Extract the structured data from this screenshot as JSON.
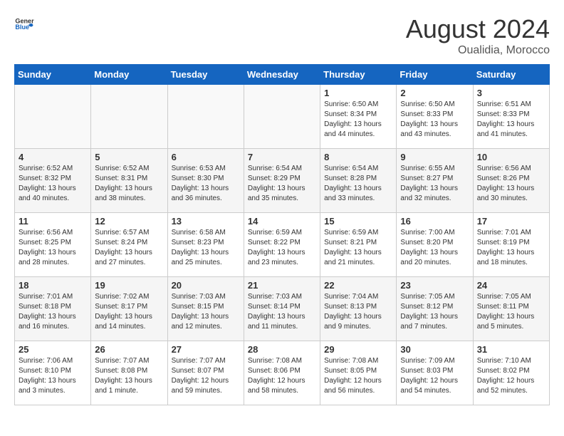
{
  "header": {
    "logo_general": "General",
    "logo_blue": "Blue",
    "month_year": "August 2024",
    "location": "Oualidia, Morocco"
  },
  "days_header": [
    "Sunday",
    "Monday",
    "Tuesday",
    "Wednesday",
    "Thursday",
    "Friday",
    "Saturday"
  ],
  "weeks": [
    [
      {
        "day": "",
        "empty": true
      },
      {
        "day": "",
        "empty": true
      },
      {
        "day": "",
        "empty": true
      },
      {
        "day": "",
        "empty": true
      },
      {
        "day": "1",
        "sunrise": "6:50 AM",
        "sunset": "8:34 PM",
        "daylight": "13 hours and 44 minutes."
      },
      {
        "day": "2",
        "sunrise": "6:50 AM",
        "sunset": "8:33 PM",
        "daylight": "13 hours and 43 minutes."
      },
      {
        "day": "3",
        "sunrise": "6:51 AM",
        "sunset": "8:33 PM",
        "daylight": "13 hours and 41 minutes."
      }
    ],
    [
      {
        "day": "4",
        "sunrise": "6:52 AM",
        "sunset": "8:32 PM",
        "daylight": "13 hours and 40 minutes."
      },
      {
        "day": "5",
        "sunrise": "6:52 AM",
        "sunset": "8:31 PM",
        "daylight": "13 hours and 38 minutes."
      },
      {
        "day": "6",
        "sunrise": "6:53 AM",
        "sunset": "8:30 PM",
        "daylight": "13 hours and 36 minutes."
      },
      {
        "day": "7",
        "sunrise": "6:54 AM",
        "sunset": "8:29 PM",
        "daylight": "13 hours and 35 minutes."
      },
      {
        "day": "8",
        "sunrise": "6:54 AM",
        "sunset": "8:28 PM",
        "daylight": "13 hours and 33 minutes."
      },
      {
        "day": "9",
        "sunrise": "6:55 AM",
        "sunset": "8:27 PM",
        "daylight": "13 hours and 32 minutes."
      },
      {
        "day": "10",
        "sunrise": "6:56 AM",
        "sunset": "8:26 PM",
        "daylight": "13 hours and 30 minutes."
      }
    ],
    [
      {
        "day": "11",
        "sunrise": "6:56 AM",
        "sunset": "8:25 PM",
        "daylight": "13 hours and 28 minutes."
      },
      {
        "day": "12",
        "sunrise": "6:57 AM",
        "sunset": "8:24 PM",
        "daylight": "13 hours and 27 minutes."
      },
      {
        "day": "13",
        "sunrise": "6:58 AM",
        "sunset": "8:23 PM",
        "daylight": "13 hours and 25 minutes."
      },
      {
        "day": "14",
        "sunrise": "6:59 AM",
        "sunset": "8:22 PM",
        "daylight": "13 hours and 23 minutes."
      },
      {
        "day": "15",
        "sunrise": "6:59 AM",
        "sunset": "8:21 PM",
        "daylight": "13 hours and 21 minutes."
      },
      {
        "day": "16",
        "sunrise": "7:00 AM",
        "sunset": "8:20 PM",
        "daylight": "13 hours and 20 minutes."
      },
      {
        "day": "17",
        "sunrise": "7:01 AM",
        "sunset": "8:19 PM",
        "daylight": "13 hours and 18 minutes."
      }
    ],
    [
      {
        "day": "18",
        "sunrise": "7:01 AM",
        "sunset": "8:18 PM",
        "daylight": "13 hours and 16 minutes."
      },
      {
        "day": "19",
        "sunrise": "7:02 AM",
        "sunset": "8:17 PM",
        "daylight": "13 hours and 14 minutes."
      },
      {
        "day": "20",
        "sunrise": "7:03 AM",
        "sunset": "8:15 PM",
        "daylight": "13 hours and 12 minutes."
      },
      {
        "day": "21",
        "sunrise": "7:03 AM",
        "sunset": "8:14 PM",
        "daylight": "13 hours and 11 minutes."
      },
      {
        "day": "22",
        "sunrise": "7:04 AM",
        "sunset": "8:13 PM",
        "daylight": "13 hours and 9 minutes."
      },
      {
        "day": "23",
        "sunrise": "7:05 AM",
        "sunset": "8:12 PM",
        "daylight": "13 hours and 7 minutes."
      },
      {
        "day": "24",
        "sunrise": "7:05 AM",
        "sunset": "8:11 PM",
        "daylight": "13 hours and 5 minutes."
      }
    ],
    [
      {
        "day": "25",
        "sunrise": "7:06 AM",
        "sunset": "8:10 PM",
        "daylight": "13 hours and 3 minutes."
      },
      {
        "day": "26",
        "sunrise": "7:07 AM",
        "sunset": "8:08 PM",
        "daylight": "13 hours and 1 minute."
      },
      {
        "day": "27",
        "sunrise": "7:07 AM",
        "sunset": "8:07 PM",
        "daylight": "12 hours and 59 minutes."
      },
      {
        "day": "28",
        "sunrise": "7:08 AM",
        "sunset": "8:06 PM",
        "daylight": "12 hours and 58 minutes."
      },
      {
        "day": "29",
        "sunrise": "7:08 AM",
        "sunset": "8:05 PM",
        "daylight": "12 hours and 56 minutes."
      },
      {
        "day": "30",
        "sunrise": "7:09 AM",
        "sunset": "8:03 PM",
        "daylight": "12 hours and 54 minutes."
      },
      {
        "day": "31",
        "sunrise": "7:10 AM",
        "sunset": "8:02 PM",
        "daylight": "12 hours and 52 minutes."
      }
    ]
  ],
  "labels": {
    "sunrise": "Sunrise:",
    "sunset": "Sunset:",
    "daylight": "Daylight:"
  }
}
